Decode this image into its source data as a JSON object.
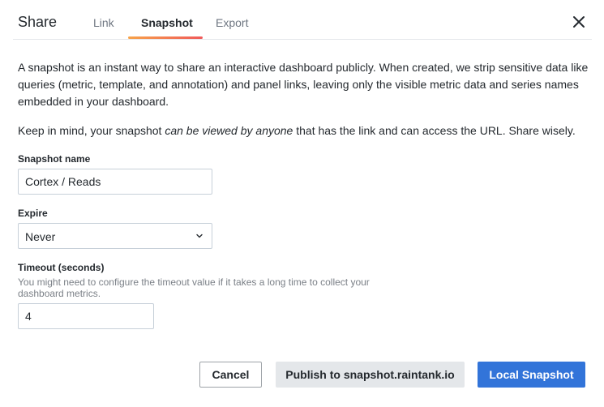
{
  "modal": {
    "title": "Share",
    "tabs": [
      {
        "label": "Link",
        "active": false
      },
      {
        "label": "Snapshot",
        "active": true
      },
      {
        "label": "Export",
        "active": false
      }
    ],
    "close_icon": "close-icon"
  },
  "description": {
    "paragraph1": "A snapshot is an instant way to share an interactive dashboard publicly. When created, we strip sensitive data like queries (metric, template, and annotation) and panel links, leaving only the visible metric data and series names embedded in your dashboard.",
    "paragraph2_before": "Keep in mind, your snapshot ",
    "paragraph2_emphasis": "can be viewed by anyone",
    "paragraph2_after": " that has the link and can access the URL. Share wisely."
  },
  "form": {
    "snapshot_name": {
      "label": "Snapshot name",
      "value": "Cortex / Reads"
    },
    "expire": {
      "label": "Expire",
      "value": "Never"
    },
    "timeout": {
      "label": "Timeout (seconds)",
      "hint": "You might need to configure the timeout value if it takes a long time to collect your dashboard metrics.",
      "value": "4"
    }
  },
  "buttons": {
    "cancel": "Cancel",
    "publish": "Publish to snapshot.raintank.io",
    "local": "Local Snapshot"
  },
  "colors": {
    "primary": "#3274d9",
    "tab_gradient_start": "#f7a34a",
    "tab_gradient_end": "#f05a5a"
  }
}
